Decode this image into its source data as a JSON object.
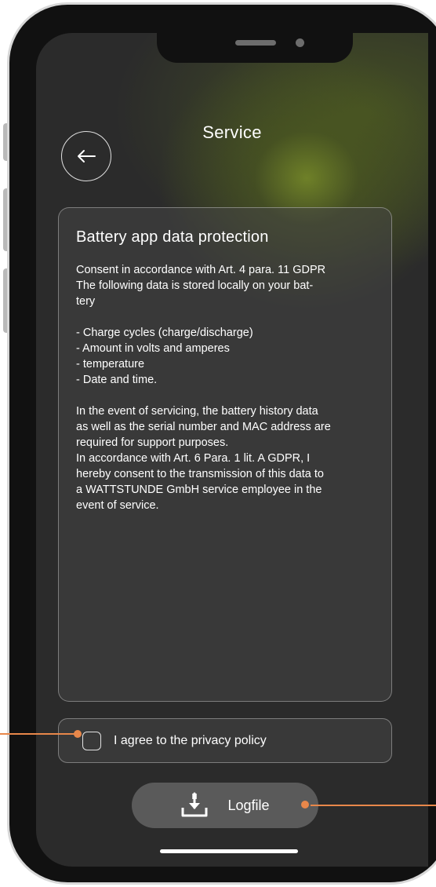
{
  "header": {
    "title": "Service",
    "back_icon": "arrow-left-icon"
  },
  "privacy_card": {
    "title": "Battery app data protection",
    "body": "Consent in accordance with Art. 4 para. 11 GDPR\nThe following data is stored locally on your bat-\ntery\n\n- Charge cycles (charge/discharge)\n- Amount in volts and amperes\n- temperature\n- Date and time.\n\nIn the event of servicing, the battery history data\nas well as the serial number and MAC address are\nrequired for support purposes.\nIn accordance with Art. 6 Para. 1 lit. A GDPR, I\nhereby consent to the transmission of this data to\na WATTSTUNDE GmbH service employee in the\nevent of service."
  },
  "consent": {
    "label": "I agree to the privacy policy",
    "checked": false
  },
  "logfile_button": {
    "label": "Logfile",
    "icon": "download-icon"
  },
  "colors": {
    "accent_callout": "#e8874a",
    "screen_background": "#2b2b2b",
    "glow": "#8a9a30",
    "button_background": "#5a5a5a"
  }
}
